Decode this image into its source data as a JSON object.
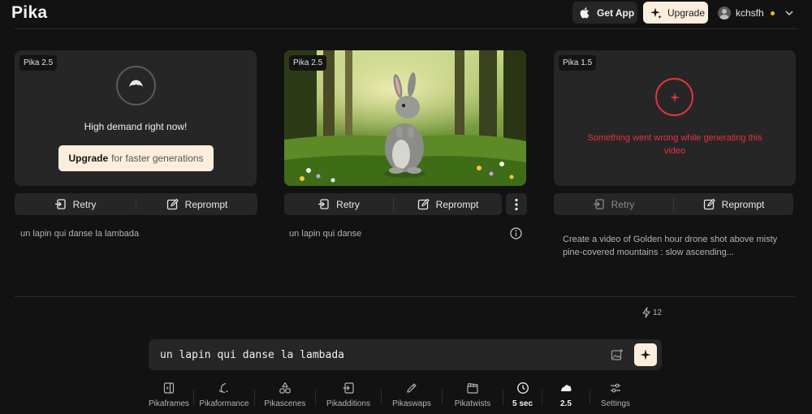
{
  "header": {
    "logo": "Pika",
    "get_app_label": "Get App",
    "upgrade_label": "Upgrade",
    "username": "kchsfh"
  },
  "cards": [
    {
      "model_badge": "Pika 2.5",
      "status_text": "High demand right now!",
      "cta_bold": "Upgrade",
      "cta_rest": "for faster generations",
      "retry_label": "Retry",
      "reprompt_label": "Reprompt",
      "prompt": "un lapin qui danse la lambada"
    },
    {
      "model_badge": "Pika 2.5",
      "retry_label": "Retry",
      "reprompt_label": "Reprompt",
      "prompt": "un lapin qui danse"
    },
    {
      "model_badge": "Pika 1.5",
      "error_text": "Something went wrong while generating this video",
      "retry_label": "Retry",
      "reprompt_label": "Reprompt",
      "prompt": "Create a video of Golden hour drone shot above misty pine-covered mountains : slow ascending..."
    }
  ],
  "credits": "12",
  "composer": {
    "value": "un lapin qui danse la lambada"
  },
  "toolbar": [
    {
      "label": "Pikaframes",
      "icon": "frames-icon"
    },
    {
      "label": "Pikaformance",
      "icon": "performance-icon"
    },
    {
      "label": "Pikascenes",
      "icon": "shapes-icon"
    },
    {
      "label": "Pikadditions",
      "icon": "add-icon"
    },
    {
      "label": "Pikaswaps",
      "icon": "swap-icon"
    },
    {
      "label": "Pikatwists",
      "icon": "clapper-icon"
    },
    {
      "label": "5 sec",
      "icon": "clock-icon"
    },
    {
      "label": "2.5",
      "icon": "cloud-icon"
    },
    {
      "label": "Settings",
      "icon": "sliders-icon"
    }
  ],
  "colors": {
    "background": "#121212",
    "surface": "#262626",
    "accent_cream": "#fbeedd",
    "error": "#e8323f",
    "notification_dot": "#f3b33c"
  }
}
